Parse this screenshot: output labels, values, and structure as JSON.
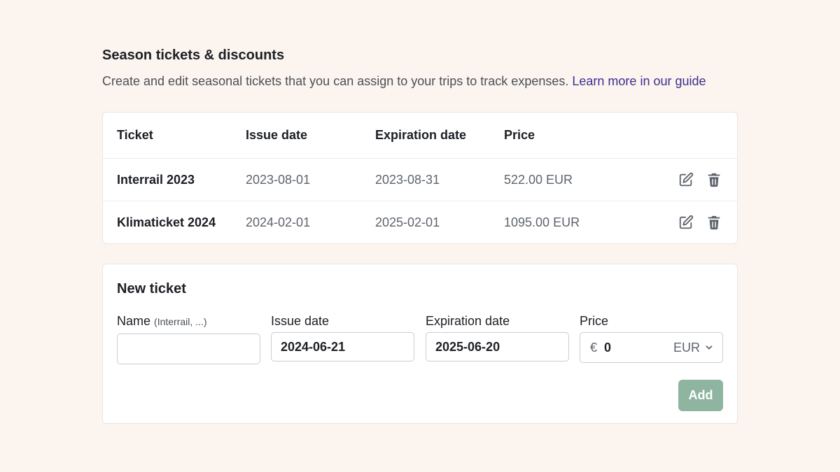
{
  "section": {
    "title": "Season tickets & discounts",
    "description": "Create and edit seasonal tickets that you can assign to your trips to track expenses.",
    "link_text": "Learn more in our guide"
  },
  "table": {
    "headers": [
      "Ticket",
      "Issue date",
      "Expiration date",
      "Price"
    ],
    "rows": [
      {
        "ticket": "Interrail 2023",
        "issue_date": "2023-08-01",
        "expiration_date": "2023-08-31",
        "price": "522.00 EUR"
      },
      {
        "ticket": "Klimaticket 2024",
        "issue_date": "2024-02-01",
        "expiration_date": "2025-02-01",
        "price": "1095.00 EUR"
      }
    ],
    "icons": {
      "edit": "edit-icon",
      "delete": "trash-icon"
    }
  },
  "new_ticket": {
    "title": "New ticket",
    "name_label": "Name",
    "name_hint": "(Interrail, ...)",
    "name_value": "",
    "issue_label": "Issue date",
    "issue_value": "2024-06-21",
    "expiration_label": "Expiration date",
    "expiration_value": "2025-06-20",
    "price_label": "Price",
    "currency_symbol": "€",
    "price_value": "0",
    "currency": "EUR",
    "add_label": "Add"
  },
  "colors": {
    "background": "#fcf4ef",
    "link": "#3b2e8f",
    "add_button": "#8fb5a1",
    "icon": "#5e646c"
  }
}
